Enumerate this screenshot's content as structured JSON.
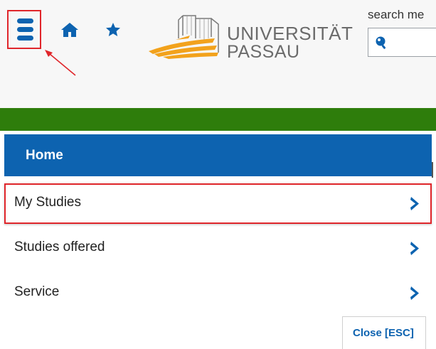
{
  "header": {
    "logo_line1": "UNIVERSITÄT",
    "logo_line2": "PASSAU",
    "search_label": "search me"
  },
  "nav": {
    "home_label": "Home",
    "items": [
      {
        "label": "My Studies",
        "highlighted": true
      },
      {
        "label": "Studies offered",
        "highlighted": false
      },
      {
        "label": "Service",
        "highlighted": false
      }
    ],
    "close_label": "Close [ESC]"
  },
  "colors": {
    "brand_blue": "#0d63b0",
    "green_bar": "#2e7d0b",
    "highlight_red": "#e0262b",
    "logo_orange": "#f2a21c"
  },
  "icons": [
    "menu-icon",
    "home-icon",
    "star-icon",
    "search-icon",
    "chevron-right-icon"
  ]
}
